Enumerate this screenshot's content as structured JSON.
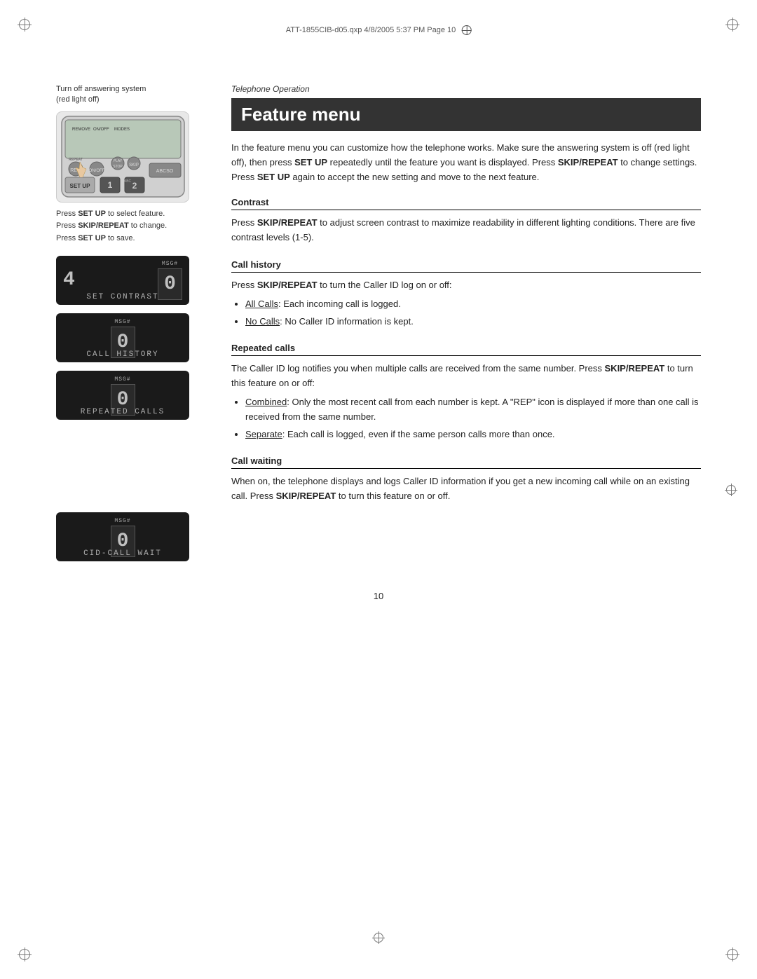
{
  "page": {
    "file_header": "ATT-1855CIB-d05.qxp  4/8/2005  5:37 PM  Page 10",
    "page_number": "10",
    "telephone_operation_label": "Telephone Operation",
    "feature_menu_title": "Feature menu",
    "intro_text": "In the feature menu you can customize how the telephone works. Make sure the answering system is off (red light off), then press SET UP repeatedly until the feature you want is displayed. Press SKIP/REPEAT to change settings. Press SET UP again to accept the new setting and move to the next feature.",
    "phone_caption_line1": "Turn off answering system",
    "phone_caption_line2": "(red light off)",
    "phone_steps": [
      "Press SET UP to select feature.",
      "Press SKIP/REPEAT to change.",
      "Press SET UP to save."
    ],
    "lcd_screens": [
      {
        "id": "set-contrast",
        "msg_label": "MSG#",
        "digit": "0",
        "number_left": "4",
        "label_bottom": "SET CONTRAST"
      },
      {
        "id": "call-history",
        "msg_label": "MSG#",
        "digit": "0",
        "number_left": "",
        "label_bottom": "CALL HISTORY"
      },
      {
        "id": "repeated-calls",
        "msg_label": "MSG#",
        "digit": "0",
        "number_left": "",
        "label_bottom": "REPEATED CALLS"
      },
      {
        "id": "cid-call-wait",
        "msg_label": "MSG#",
        "digit": "0",
        "number_left": "",
        "label_bottom": "CID-CALL WAIT"
      }
    ],
    "sections": [
      {
        "id": "contrast",
        "heading": "Contrast",
        "body": "Press SKIP/REPEAT to adjust screen contrast to maximize readability in different lighting conditions. There are five contrast levels (1-5)."
      },
      {
        "id": "call-history",
        "heading": "Call history",
        "body_intro": "Press SKIP/REPEAT to turn the Caller ID log on or off:",
        "bullets": [
          "All Calls: Each incoming call is logged.",
          "No Calls: No Caller ID information is kept."
        ]
      },
      {
        "id": "repeated-calls",
        "heading": "Repeated calls",
        "body_intro": "The Caller ID log notifies you when multiple calls are received from the same number. Press SKIP/REPEAT to turn this feature on or off:",
        "bullets": [
          "Combined: Only the most recent call from each number is kept. A “REP” icon is displayed if more than one call is received from the same number.",
          "Separate: Each call is logged, even if the same person calls more than once."
        ]
      },
      {
        "id": "call-waiting",
        "heading": "Call waiting",
        "body": "When on, the telephone displays and logs Caller ID information if you get a new incoming call while on an existing call. Press SKIP/REPEAT to turn this feature on or off."
      }
    ]
  }
}
